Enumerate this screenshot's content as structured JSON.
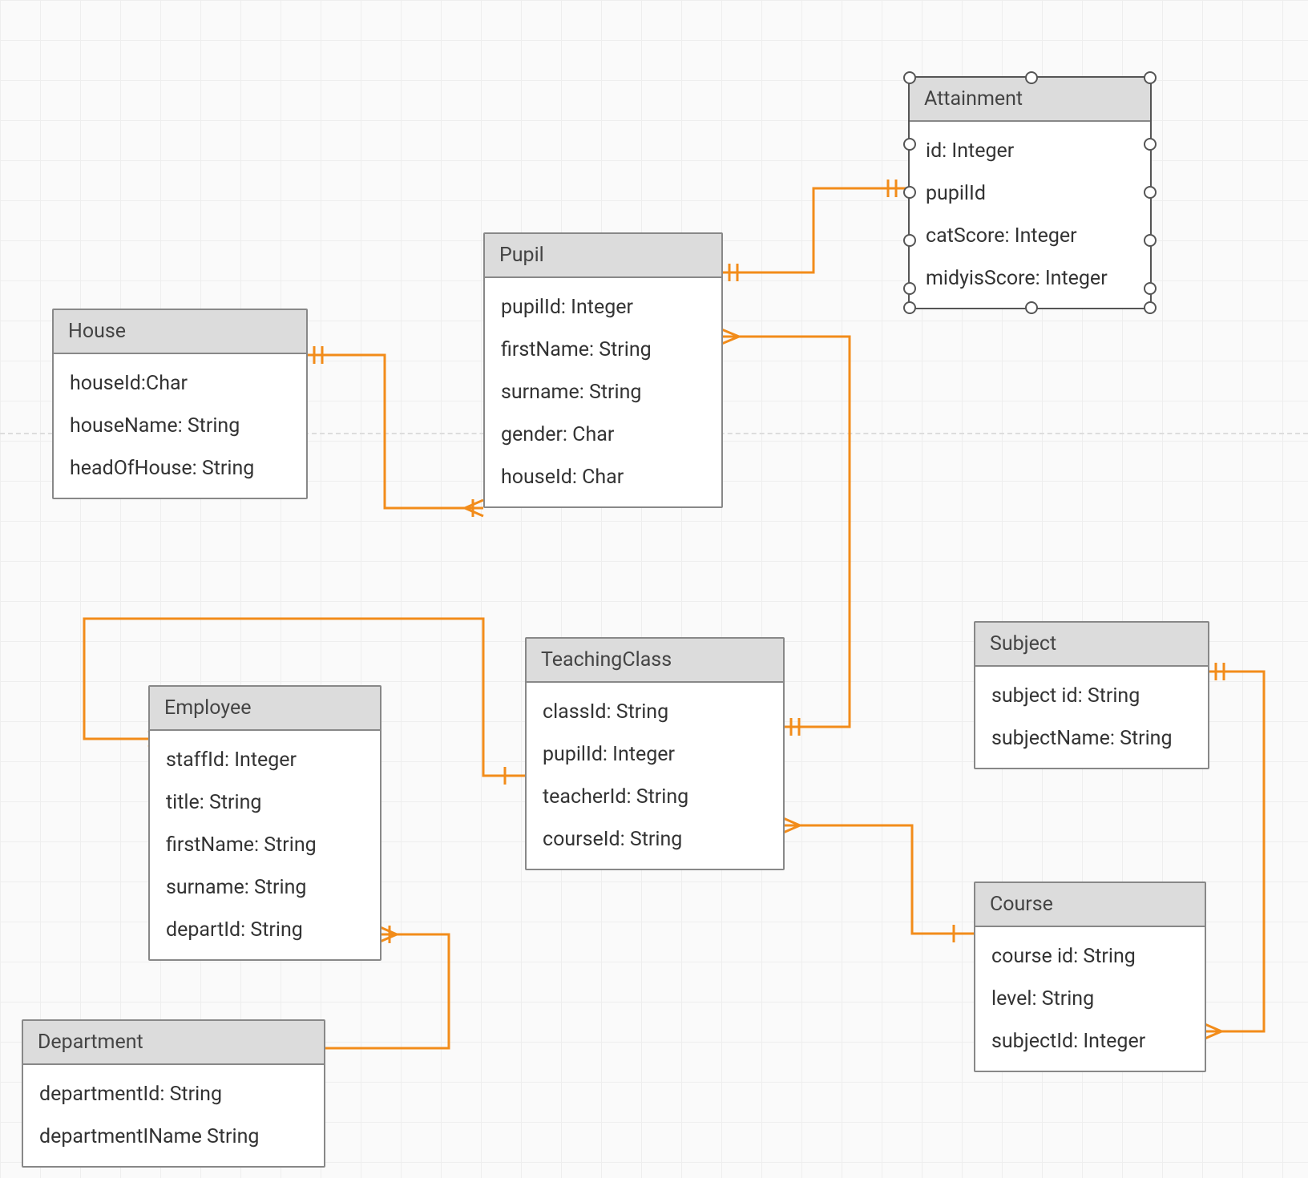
{
  "entities": {
    "house": {
      "title": "House",
      "rows": [
        "houseId:Char",
        "houseName: String",
        "headOfHouse: String"
      ]
    },
    "pupil": {
      "title": "Pupil",
      "rows": [
        "pupilId: Integer",
        "firstName: String",
        "surname: String",
        "gender: Char",
        "houseId: Char"
      ]
    },
    "attainment": {
      "title": "Attainment",
      "rows": [
        "id: Integer",
        "pupilId",
        "catScore: Integer",
        "midyisScore: Integer"
      ]
    },
    "employee": {
      "title": "Employee",
      "rows": [
        "staffId: Integer",
        "title: String",
        "firstName: String",
        "surname: String",
        "departId: String"
      ]
    },
    "teachingclass": {
      "title": "TeachingClass",
      "rows": [
        "classId: String",
        "pupilId: Integer",
        "teacherId: String",
        "courseId: String"
      ]
    },
    "subject": {
      "title": "Subject",
      "rows": [
        "subject id: String",
        "subjectName: String"
      ]
    },
    "course": {
      "title": "Course",
      "rows": [
        "course id: String",
        "level: String",
        "subjectId: Integer"
      ]
    },
    "department": {
      "title": "Department",
      "rows": [
        "departmentId: String",
        "departmentIName String"
      ]
    }
  },
  "relationships": [
    {
      "from": "House.houseId",
      "to": "Pupil.houseId",
      "type": "one-to-many"
    },
    {
      "from": "Pupil.pupilId",
      "to": "Attainment.pupilId",
      "type": "one-to-one"
    },
    {
      "from": "Pupil.pupilId",
      "to": "TeachingClass.pupilId",
      "type": "one-to-many"
    },
    {
      "from": "Employee.staffId",
      "to": "TeachingClass.teacherId",
      "type": "one-to-many"
    },
    {
      "from": "Department.departmentId",
      "to": "Employee.departId",
      "type": "one-to-many"
    },
    {
      "from": "Course.courseId",
      "to": "TeachingClass.courseId",
      "type": "one-to-many"
    },
    {
      "from": "Subject.subjectId",
      "to": "Course.subjectId",
      "type": "one-to-many"
    }
  ]
}
